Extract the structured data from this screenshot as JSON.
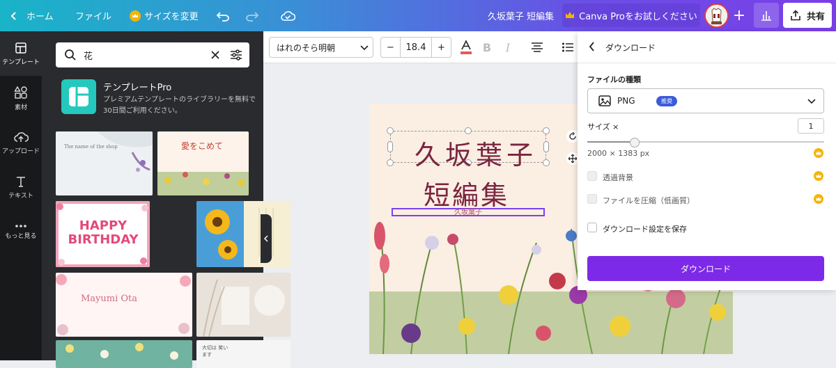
{
  "topbar": {
    "home_label": "ホーム",
    "file_label": "ファイル",
    "resize_label": "サイズを変更",
    "doc_title": "久坂葉子 短編集",
    "pro_label": "Canva Proをお試しください",
    "share_label": "共有"
  },
  "sidebar": {
    "items": [
      {
        "label": "テンプレート",
        "icon": "template-icon"
      },
      {
        "label": "素材",
        "icon": "elements-icon"
      },
      {
        "label": "アップロード",
        "icon": "upload-icon"
      },
      {
        "label": "テキスト",
        "icon": "text-icon"
      },
      {
        "label": "もっと見る",
        "icon": "more-icon"
      }
    ]
  },
  "panel": {
    "search_value": "花",
    "pro_title": "テンプレートPro",
    "pro_desc": "プレミアムテンプレートのライブラリーを無料で30日間ご利用ください。",
    "thumbs": [
      {
        "text": "The name of the shop",
        "bg": "#eef1f3"
      },
      {
        "text": "愛をこめて",
        "bg": "#fdf3ea"
      },
      {
        "text": "HAPPY BIRTHDAY",
        "bg": "#ffffff"
      },
      {
        "text": "",
        "bg": "#4a9ed8"
      },
      {
        "text": "Mayumi Ota",
        "bg": "#fff5f5"
      },
      {
        "text": "",
        "bg": "#e8e2da"
      },
      {
        "text": "",
        "bg": "#6fb3a0"
      },
      {
        "text": "大切は 笑います",
        "bg": "#f5f5f5"
      }
    ]
  },
  "toolbar": {
    "font_name": "はれのそら明朝",
    "font_size": "18.4",
    "minus_label": "−",
    "plus_label": "+"
  },
  "canvas": {
    "title": "久坂葉子",
    "subtitle": "短編集",
    "author": "久坂葉子"
  },
  "download_panel": {
    "title": "ダウンロード",
    "file_type_label": "ファイルの種類",
    "file_type_value": "PNG",
    "recommended_badge": "推奨",
    "size_label": "サイズ ×",
    "size_value": "1",
    "slider_fraction": 0.2,
    "dimensions": "2000 × 1383 px",
    "transparent_label": "透過背景",
    "compress_label": "ファイルを圧縮（低画質）",
    "save_settings_label": "ダウンロード設定を保存",
    "download_button": "ダウンロード"
  },
  "colors": {
    "accent": "#7d2ae8",
    "crown": "#f5b400",
    "title_color": "#7a2440"
  }
}
